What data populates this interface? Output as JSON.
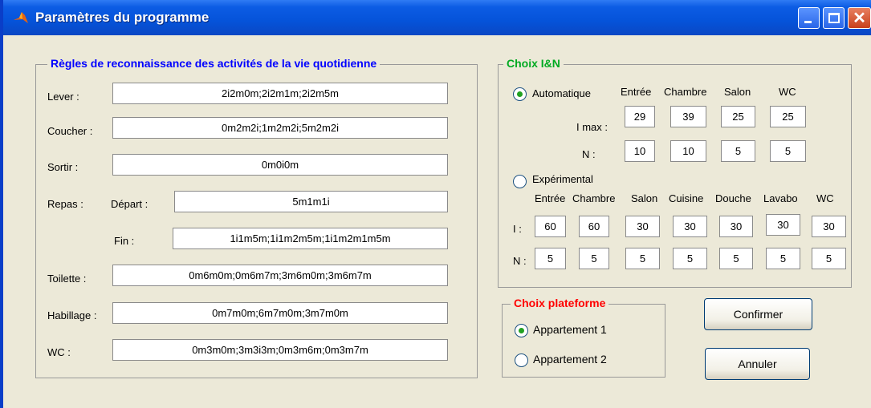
{
  "window": {
    "title": "Paramètres du programme",
    "close_glyph": "✕",
    "icons": {
      "app": "matlab-icon",
      "minimize": "minimize-icon",
      "maximize": "maximize-icon",
      "close": "close-icon"
    }
  },
  "regles": {
    "legend": "Règles de reconnaissance des activités de la vie quotidienne",
    "lever": {
      "label": "Lever :",
      "value": "2i2m0m;2i2m1m;2i2m5m"
    },
    "coucher": {
      "label": "Coucher :",
      "value": "0m2m2i;1m2m2i;5m2m2i"
    },
    "sortir": {
      "label": "Sortir :",
      "value": "0m0i0m"
    },
    "repas": {
      "label": "Repas :",
      "depart_label": "Départ :",
      "depart_value": "5m1m1i",
      "fin_label": "Fin :",
      "fin_value": "1i1m5m;1i1m2m5m;1i1m2m1m5m"
    },
    "toilette": {
      "label": "Toilette :",
      "value": "0m6m0m;0m6m7m;3m6m0m;3m6m7m"
    },
    "habillage": {
      "label": "Habillage :",
      "value": "0m7m0m;6m7m0m;3m7m0m"
    },
    "wc": {
      "label": "WC :",
      "value": "0m3m0m;3m3i3m;0m3m6m;0m3m7m"
    }
  },
  "choix_in": {
    "legend": "Choix I&N",
    "automatique": {
      "label": "Automatique",
      "selected": true,
      "headers": [
        "Entrée",
        "Chambre",
        "Salon",
        "WC"
      ],
      "imax_label": "I max :",
      "imax": [
        "29",
        "39",
        "25",
        "25"
      ],
      "n_label": "N :",
      "n": [
        "10",
        "10",
        "5",
        "5"
      ]
    },
    "experimental": {
      "label": "Expérimental",
      "selected": false,
      "headers": [
        "Entrée",
        "Chambre",
        "Salon",
        "Cuisine",
        "Douche",
        "Lavabo",
        "WC"
      ],
      "i_label": "I :",
      "i": [
        "60",
        "60",
        "30",
        "30",
        "30",
        "30",
        "30"
      ],
      "n_label": "N :",
      "n": [
        "5",
        "5",
        "5",
        "5",
        "5",
        "5",
        "5"
      ]
    }
  },
  "plateforme": {
    "legend": "Choix plateforme",
    "options": [
      {
        "label": "Appartement 1",
        "selected": true
      },
      {
        "label": "Appartement 2",
        "selected": false
      }
    ]
  },
  "buttons": {
    "confirmer": "Confirmer",
    "annuler": "Annuler"
  },
  "colors": {
    "title_bar": "#0553d9",
    "regles_legend": "#0000ff",
    "choix_legend": "#00aa22",
    "plateforme_legend": "#ff0000",
    "radio_on": "#21a121"
  }
}
